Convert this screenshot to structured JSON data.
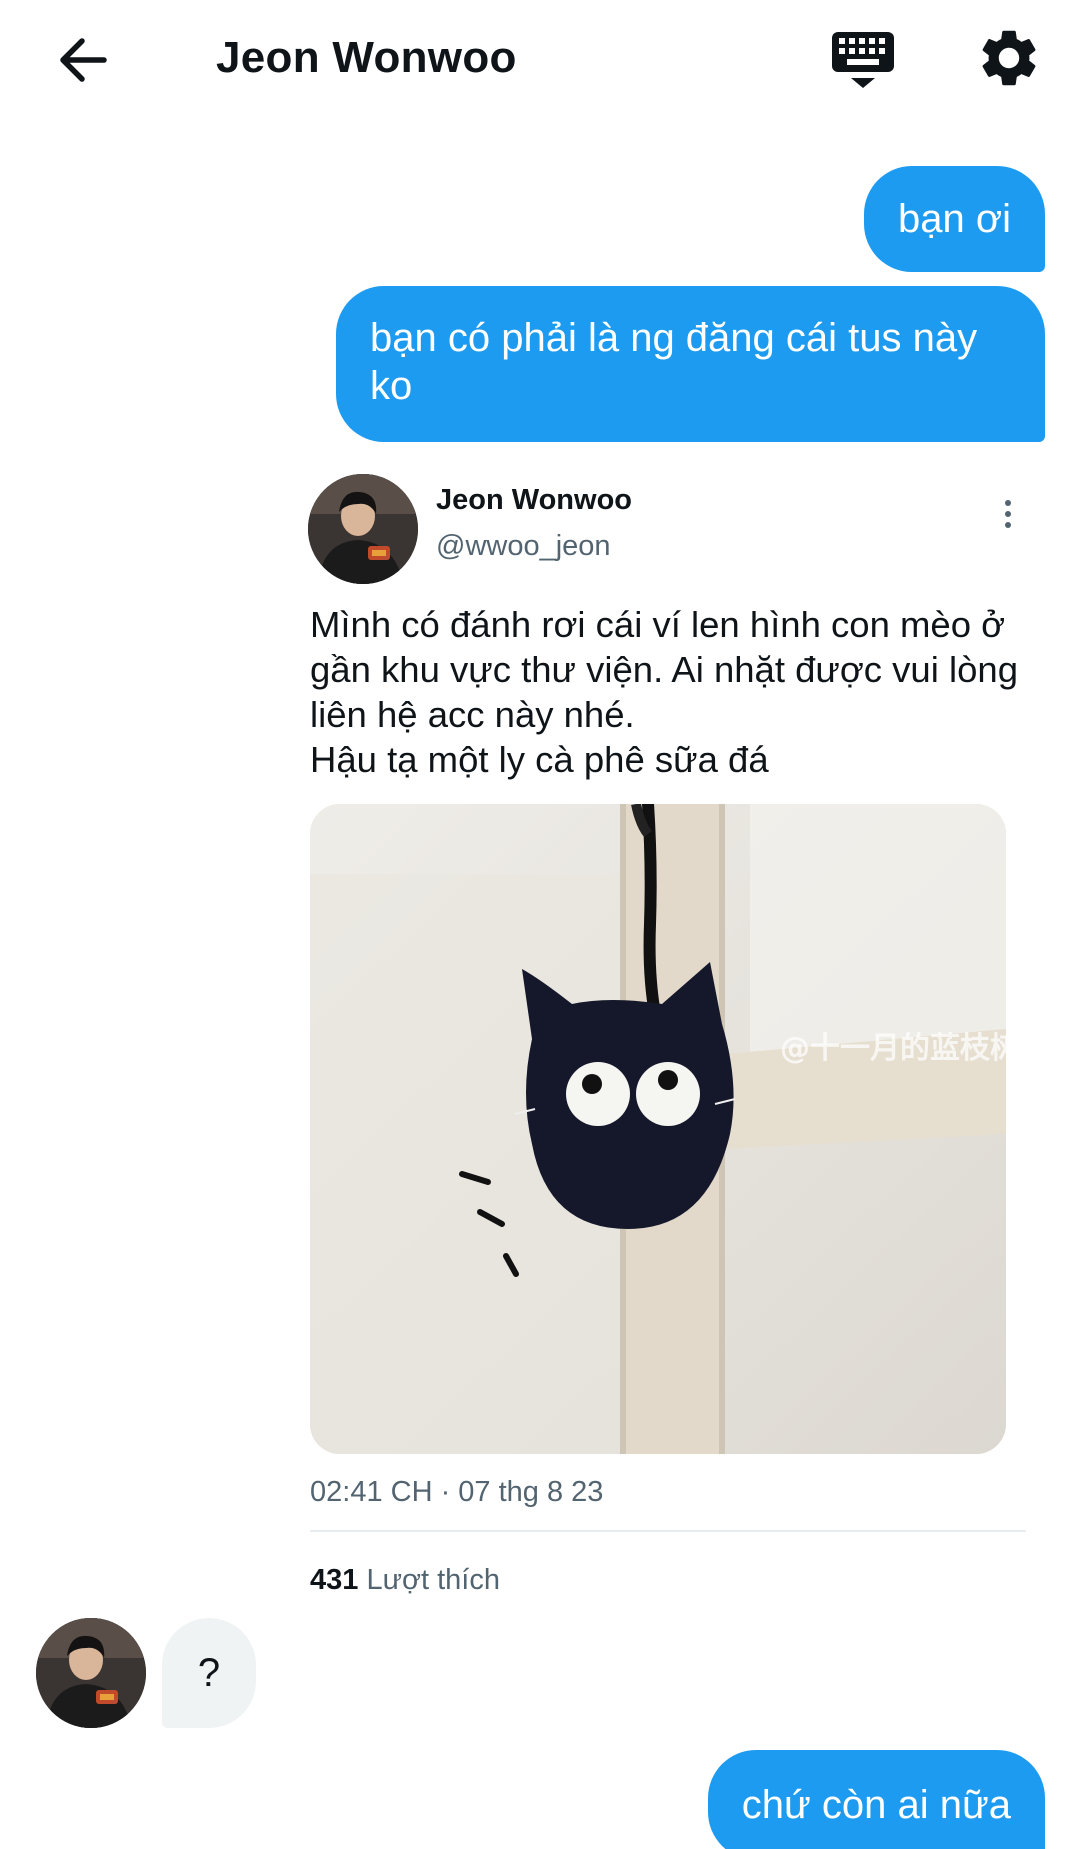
{
  "header": {
    "title": "Jeon Wonwoo",
    "back_icon": "arrow-left-icon",
    "keyboard_icon": "keyboard-icon",
    "settings_icon": "gear-icon"
  },
  "messages": {
    "out_1": "bạn ơi",
    "out_2": "bạn có phải là ng đăng cái tus này ko",
    "in_1": "?",
    "out_3": "chứ còn ai nữa"
  },
  "tweet": {
    "name": "Jeon Wonwoo",
    "handle": "@wwoo_jeon",
    "text_lines": [
      "Mình có đánh rơi cái ví len hình con mèo ở",
      "gần khu vực thư viện. Ai nhặt được vui lòng",
      "liên hệ acc này nhé.",
      "Hậu tạ một ly cà phê sữa đá"
    ],
    "image_watermark": "@十一月的蓝枝树",
    "timestamp": "02:41 CH · 07 thg 8 23",
    "likes_count": "431",
    "likes_label": "Lượt thích"
  },
  "colors": {
    "accent": "#1d9bf0",
    "incoming_bubble": "#eff3f4",
    "secondary_text": "#536471"
  }
}
